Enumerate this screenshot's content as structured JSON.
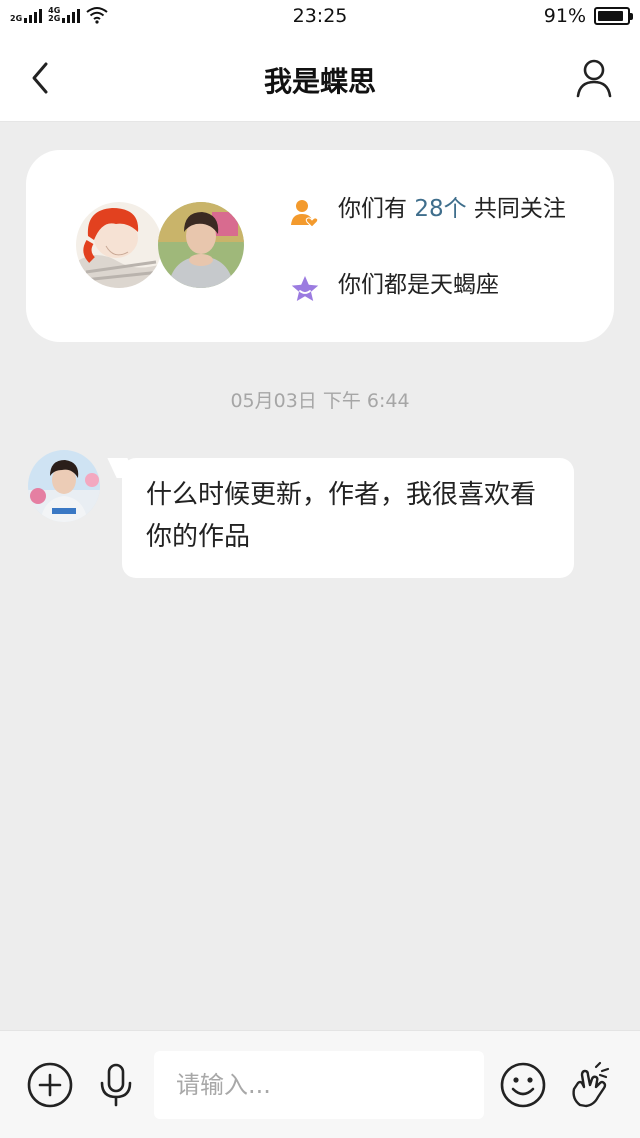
{
  "status_bar": {
    "net1": "2G",
    "net2_top": "4G",
    "net2_bottom": "2G",
    "time": "23:25",
    "battery": "91%",
    "battery_level": 0.91
  },
  "header": {
    "title": "我是蝶思"
  },
  "info_card": {
    "mutual_prefix": "你们有 ",
    "mutual_count": "28个",
    "mutual_suffix": " 共同关注",
    "zodiac_text": "你们都是天蝎座"
  },
  "chat": {
    "timestamp": "05月03日 下午 6:44",
    "messages": [
      {
        "text": "什么时候更新，作者，我很喜欢看你的作品"
      }
    ]
  },
  "input_bar": {
    "placeholder": "请输入..."
  },
  "icons": {
    "back": "chevron-left-icon",
    "profile": "person-icon",
    "mutual": "person-heart-icon",
    "zodiac": "star-icon",
    "plus": "plus-circle-icon",
    "mic": "microphone-icon",
    "emoji": "smiley-icon",
    "hand": "finger-heart-icon"
  },
  "colors": {
    "accent_blue": "#3f6e8c",
    "orange_icon": "#f39a2d",
    "purple_icon": "#9b7be0",
    "background": "#ededed"
  }
}
